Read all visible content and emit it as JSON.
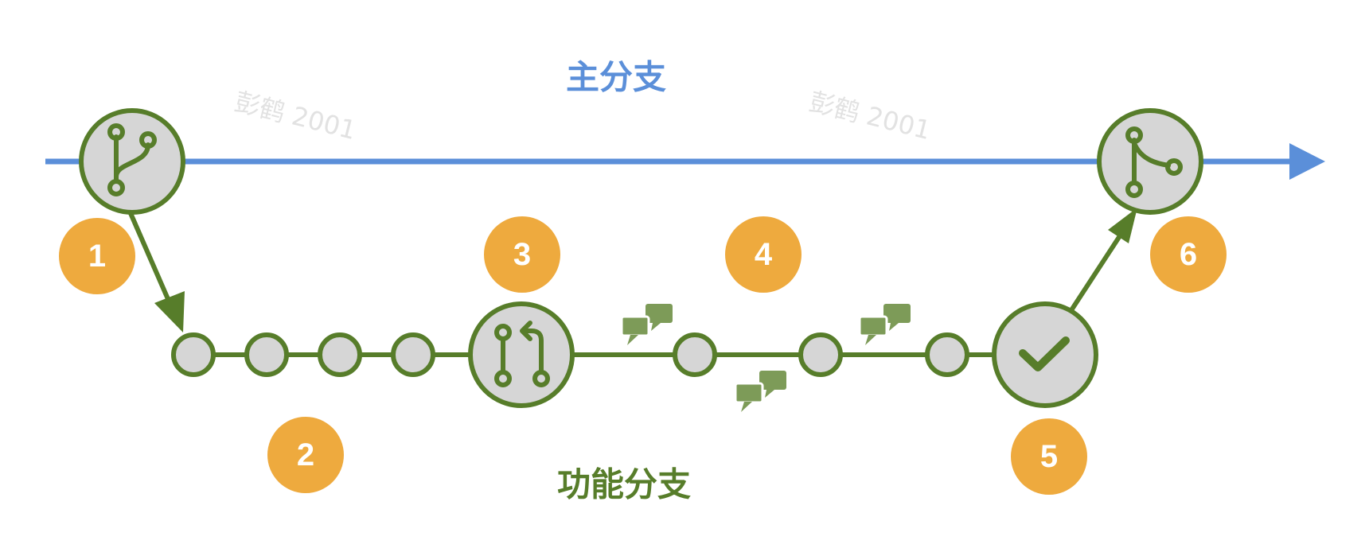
{
  "labels": {
    "main_branch": "主分支",
    "feature_branch": "功能分支"
  },
  "watermarks": [
    "彭鹤 2001",
    "彭鹤 2001"
  ],
  "steps": [
    "1",
    "2",
    "3",
    "4",
    "5",
    "6"
  ],
  "colors": {
    "main_line": "#5b8fd9",
    "feature_green": "#577d2a",
    "comment_green": "#7d9b58",
    "node_fill": "#d6d6d6",
    "badge_orange": "#eeaa3e"
  },
  "icons": {
    "branch_node": "git-branch-icon",
    "pull_request_node": "git-pull-request-icon",
    "review_node": "check-icon",
    "merge_node": "git-merge-icon",
    "comments": "comment-bubbles-icon"
  }
}
